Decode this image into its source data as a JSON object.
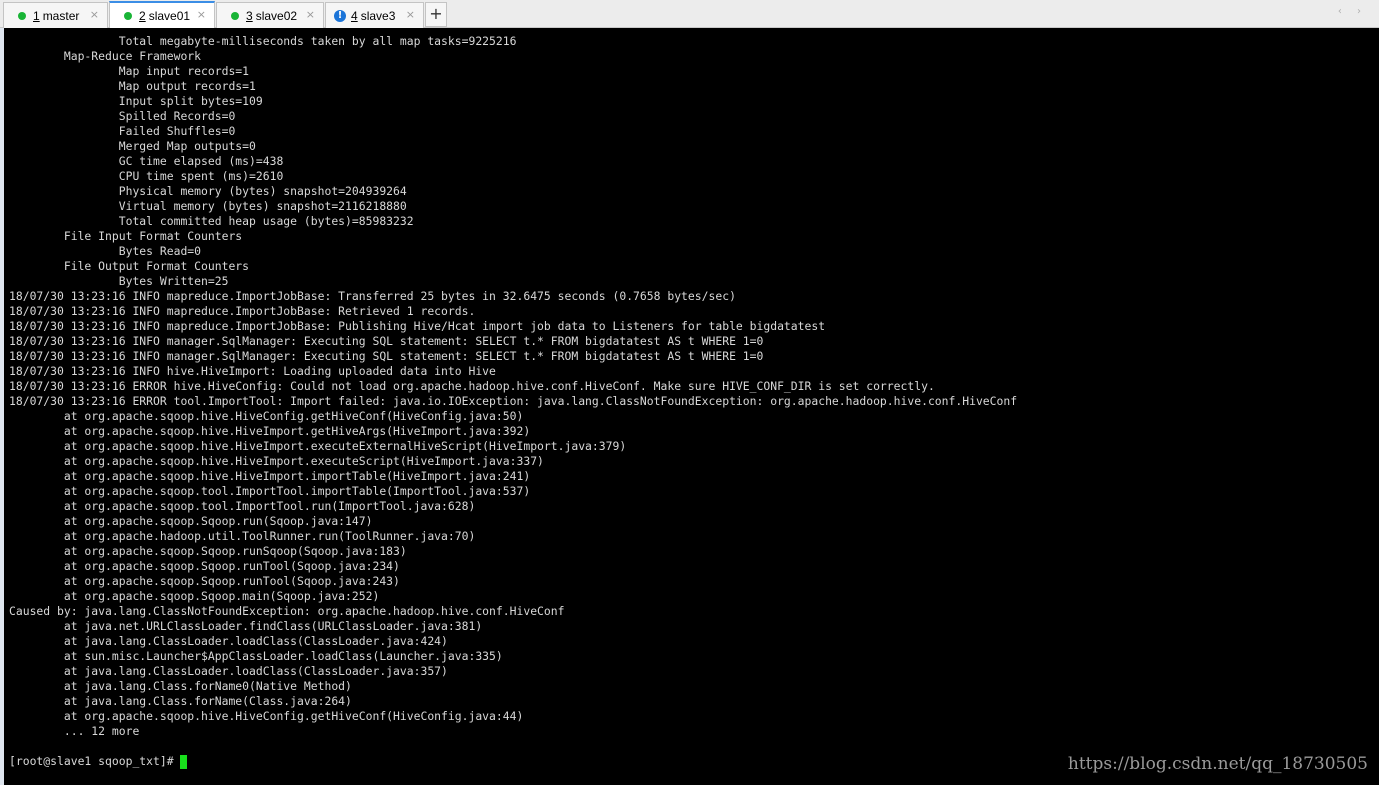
{
  "tabs": [
    {
      "num": "1",
      "label": "master",
      "status": "connected"
    },
    {
      "num": "2",
      "label": "slave01",
      "status": "connected"
    },
    {
      "num": "3",
      "label": "slave02",
      "status": "connected"
    },
    {
      "num": "4",
      "label": "slave3",
      "status": "warning"
    }
  ],
  "tab_close_glyph": "×",
  "add_tab_glyph": "+",
  "nav_arrows": "‹ ›",
  "terminal_lines": [
    "                Total megabyte-milliseconds taken by all map tasks=9225216",
    "        Map-Reduce Framework",
    "                Map input records=1",
    "                Map output records=1",
    "                Input split bytes=109",
    "                Spilled Records=0",
    "                Failed Shuffles=0",
    "                Merged Map outputs=0",
    "                GC time elapsed (ms)=438",
    "                CPU time spent (ms)=2610",
    "                Physical memory (bytes) snapshot=204939264",
    "                Virtual memory (bytes) snapshot=2116218880",
    "                Total committed heap usage (bytes)=85983232",
    "        File Input Format Counters",
    "                Bytes Read=0",
    "        File Output Format Counters",
    "                Bytes Written=25",
    "18/07/30 13:23:16 INFO mapreduce.ImportJobBase: Transferred 25 bytes in 32.6475 seconds (0.7658 bytes/sec)",
    "18/07/30 13:23:16 INFO mapreduce.ImportJobBase: Retrieved 1 records.",
    "18/07/30 13:23:16 INFO mapreduce.ImportJobBase: Publishing Hive/Hcat import job data to Listeners for table bigdatatest",
    "18/07/30 13:23:16 INFO manager.SqlManager: Executing SQL statement: SELECT t.* FROM bigdatatest AS t WHERE 1=0",
    "18/07/30 13:23:16 INFO manager.SqlManager: Executing SQL statement: SELECT t.* FROM bigdatatest AS t WHERE 1=0",
    "18/07/30 13:23:16 INFO hive.HiveImport: Loading uploaded data into Hive",
    "18/07/30 13:23:16 ERROR hive.HiveConfig: Could not load org.apache.hadoop.hive.conf.HiveConf. Make sure HIVE_CONF_DIR is set correctly.",
    "18/07/30 13:23:16 ERROR tool.ImportTool: Import failed: java.io.IOException: java.lang.ClassNotFoundException: org.apache.hadoop.hive.conf.HiveConf",
    "        at org.apache.sqoop.hive.HiveConfig.getHiveConf(HiveConfig.java:50)",
    "        at org.apache.sqoop.hive.HiveImport.getHiveArgs(HiveImport.java:392)",
    "        at org.apache.sqoop.hive.HiveImport.executeExternalHiveScript(HiveImport.java:379)",
    "        at org.apache.sqoop.hive.HiveImport.executeScript(HiveImport.java:337)",
    "        at org.apache.sqoop.hive.HiveImport.importTable(HiveImport.java:241)",
    "        at org.apache.sqoop.tool.ImportTool.importTable(ImportTool.java:537)",
    "        at org.apache.sqoop.tool.ImportTool.run(ImportTool.java:628)",
    "        at org.apache.sqoop.Sqoop.run(Sqoop.java:147)",
    "        at org.apache.hadoop.util.ToolRunner.run(ToolRunner.java:70)",
    "        at org.apache.sqoop.Sqoop.runSqoop(Sqoop.java:183)",
    "        at org.apache.sqoop.Sqoop.runTool(Sqoop.java:234)",
    "        at org.apache.sqoop.Sqoop.runTool(Sqoop.java:243)",
    "        at org.apache.sqoop.Sqoop.main(Sqoop.java:252)",
    "Caused by: java.lang.ClassNotFoundException: org.apache.hadoop.hive.conf.HiveConf",
    "        at java.net.URLClassLoader.findClass(URLClassLoader.java:381)",
    "        at java.lang.ClassLoader.loadClass(ClassLoader.java:424)",
    "        at sun.misc.Launcher$AppClassLoader.loadClass(Launcher.java:335)",
    "        at java.lang.ClassLoader.loadClass(ClassLoader.java:357)",
    "        at java.lang.Class.forName0(Native Method)",
    "        at java.lang.Class.forName(Class.java:264)",
    "        at org.apache.sqoop.hive.HiveConfig.getHiveConf(HiveConfig.java:44)",
    "        ... 12 more"
  ],
  "prompt": "[root@slave1 sqoop_txt]#",
  "watermark": "https://blog.csdn.net/qq_18730505",
  "colors": {
    "terminal_bg": "#000000",
    "terminal_text": "#d8d8d8",
    "cursor": "#18e01c",
    "status_connected": "#19b436",
    "status_warning": "#1b74d8",
    "active_tab_accent": "#3b8ee6"
  }
}
